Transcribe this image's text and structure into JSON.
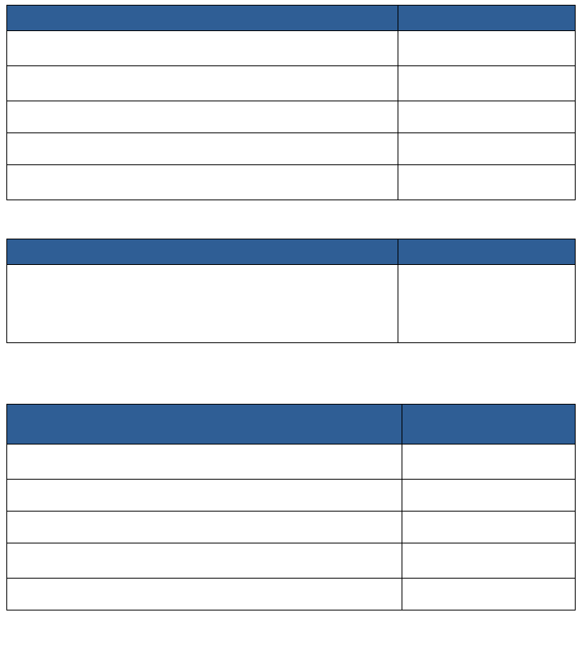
{
  "tables": [
    {
      "headers": [
        "",
        ""
      ],
      "rows": [
        [
          "",
          ""
        ],
        [
          "",
          ""
        ],
        [
          "",
          ""
        ],
        [
          "",
          ""
        ],
        [
          "",
          ""
        ]
      ]
    },
    {
      "headers": [
        "",
        ""
      ],
      "rows": [
        [
          "",
          ""
        ]
      ]
    },
    {
      "headers": [
        "",
        ""
      ],
      "rows": [
        [
          "",
          ""
        ],
        [
          "",
          ""
        ],
        [
          "",
          ""
        ],
        [
          "",
          ""
        ],
        [
          "",
          ""
        ]
      ]
    }
  ]
}
